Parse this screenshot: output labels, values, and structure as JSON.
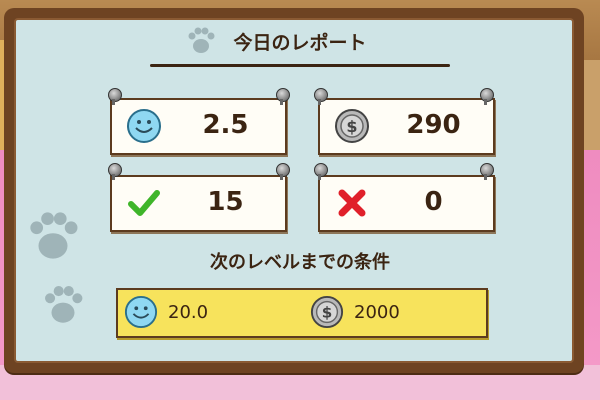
{
  "report": {
    "title": "今日のレポート",
    "stats": {
      "satisfaction": "2.5",
      "coins": "290",
      "correct": "15",
      "wrong": "0"
    }
  },
  "next_level": {
    "title": "次のレベルまでの条件",
    "satisfaction": "20.0",
    "coins": "2000"
  },
  "icons": {
    "satisfaction": "smiley-face-icon",
    "coins": "silver-coin-icon",
    "correct": "green-checkmark-icon",
    "wrong": "red-cross-icon",
    "decoration": "paw-print-icon"
  },
  "colors": {
    "board_frame": "#6e4322",
    "board_panel": "#cfe4e6",
    "card": "#fffdf6",
    "banner": "#f7e35c",
    "text": "#3b2412",
    "check": "#3fb52a",
    "cross": "#e0202a"
  }
}
